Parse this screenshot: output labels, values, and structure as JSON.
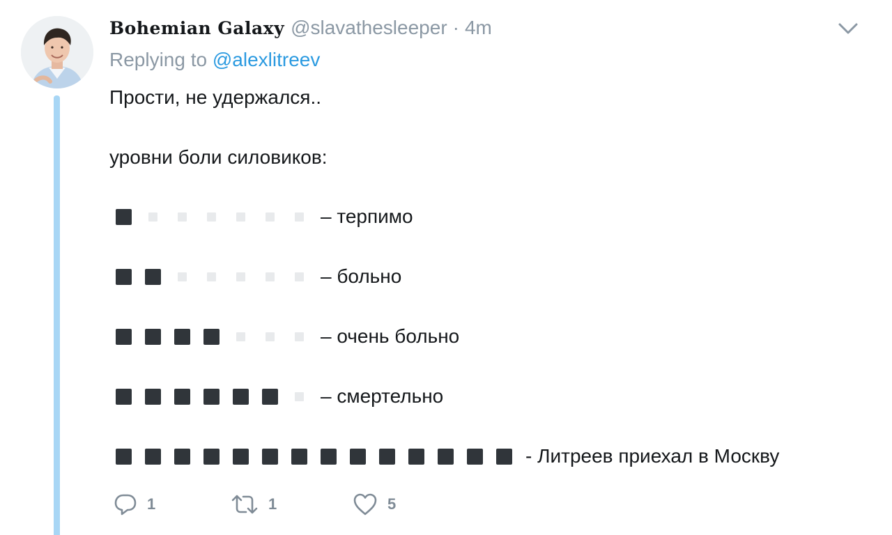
{
  "tweet": {
    "display_name": "Bohemian Galaxy",
    "handle": "@slavathesleeper",
    "separator": "·",
    "time": "4m",
    "replying_prefix": "Replying to",
    "replying_to": "@alexlitreev",
    "text_line1": "Прости, не удержался..",
    "text_line2": "уровни боли силовиков:",
    "pain_levels": [
      {
        "filled": 1,
        "empty": 6,
        "label": "– терпимо"
      },
      {
        "filled": 2,
        "empty": 5,
        "label": "– больно"
      },
      {
        "filled": 4,
        "empty": 3,
        "label": "– очень больно"
      },
      {
        "filled": 6,
        "empty": 1,
        "label": "– смертельно"
      },
      {
        "filled": 14,
        "empty": 0,
        "label": "- Литреев приехал в Москву"
      }
    ]
  },
  "actions": {
    "reply_count": "1",
    "retweet_count": "1",
    "like_count": "5",
    "reply_icon": "speech-bubble-icon",
    "retweet_icon": "retweet-arrows-icon",
    "like_icon": "heart-icon"
  },
  "colors": {
    "link": "#2b9ae0",
    "muted": "#8b98a4",
    "thread_line": "#a8d6f5",
    "filled_square": "#30353a",
    "empty_square": "#e8eaec"
  }
}
